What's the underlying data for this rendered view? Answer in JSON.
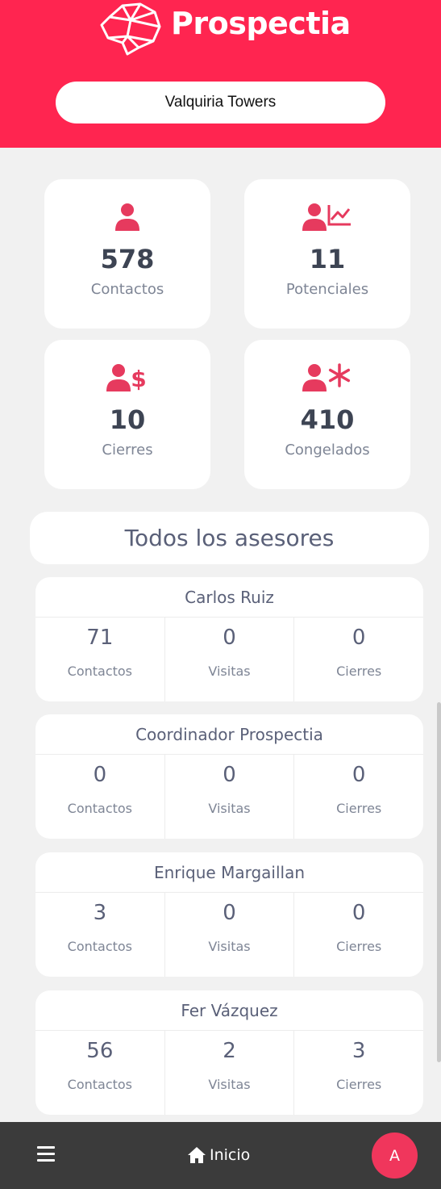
{
  "app": {
    "name": "Prospectia",
    "brand_color": "#ff2550"
  },
  "project": {
    "name": "Valquiria Towers"
  },
  "stats": [
    {
      "icon": "user-icon",
      "value": "578",
      "label": "Contactos"
    },
    {
      "icon": "user-chart-icon",
      "value": "11",
      "label": "Potenciales"
    },
    {
      "icon": "user-dollar-icon",
      "value": "10",
      "label": "Cierres"
    },
    {
      "icon": "user-snowflake-icon",
      "value": "410",
      "label": "Congelados"
    }
  ],
  "section": {
    "title": "Todos los asesores"
  },
  "advisors": [
    {
      "name": "Carlos Ruiz",
      "contactos": "71",
      "visitas": "0",
      "cierres": "0"
    },
    {
      "name": "Coordinador Prospectia",
      "contactos": "0",
      "visitas": "0",
      "cierres": "0"
    },
    {
      "name": "Enrique Margaillan",
      "contactos": "3",
      "visitas": "0",
      "cierres": "0"
    },
    {
      "name": "Fer Vázquez",
      "contactos": "56",
      "visitas": "2",
      "cierres": "3"
    }
  ],
  "advisor_labels": {
    "contactos": "Contactos",
    "visitas": "Visitas",
    "cierres": "Cierres"
  },
  "nav": {
    "menu_icon": "hamburger-icon",
    "home_icon": "home-icon",
    "home_label": "Inicio",
    "avatar_initial": "A"
  }
}
